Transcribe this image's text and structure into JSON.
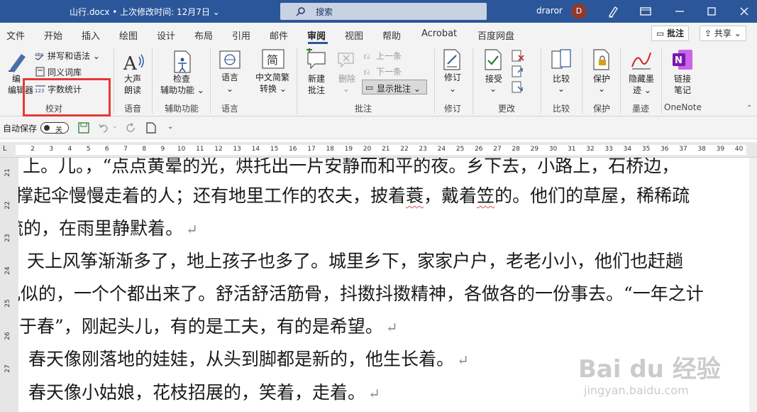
{
  "titlebar": {
    "doc_title": "山行.docx • 上次修改时间: 12月7日 ⌄",
    "search_label": "搜索",
    "username": "draror",
    "avatar_initial": "D",
    "accent_color": "#2b579a"
  },
  "menu": {
    "tabs": [
      "文件",
      "开始",
      "插入",
      "绘图",
      "设计",
      "布局",
      "引用",
      "邮件",
      "审阅",
      "视图",
      "帮助",
      "Acrobat",
      "百度网盘"
    ],
    "active_tab": "审阅",
    "comment_button": "批注",
    "share_button": "共享 ⌄"
  },
  "ribbon": {
    "proofing": {
      "edit_label_1": "编",
      "edit_label_2": "编辑器",
      "spelling": "拼写和语法 ⌄",
      "thesaurus": "同义词库",
      "word_count": "字数统计",
      "group": "校对"
    },
    "speech": {
      "read_aloud_1": "大声",
      "read_aloud_2": "朗读",
      "group": "语音"
    },
    "accessibility": {
      "check_1": "检查",
      "check_2": "辅助功能 ⌄",
      "group": "辅助功能"
    },
    "language": {
      "language": "语言",
      "language_arrow": "⌄",
      "group": "语言"
    },
    "chinese": {
      "convert_1": "中文简繁",
      "convert_2": "转换 ⌄"
    },
    "comments": {
      "new_comment_1": "新建",
      "new_comment_2": "批注",
      "delete": "删除",
      "delete_arrow": "⌄",
      "previous": "上一条",
      "next": "下一条",
      "show_comments": "显示批注 ⌄",
      "group": "批注"
    },
    "tracking": {
      "track_changes": "修订",
      "track_arrow": "⌄",
      "group": "修订"
    },
    "changes": {
      "accept": "接受",
      "accept_arrow": "⌄",
      "group": "更改"
    },
    "compare": {
      "compare": "比较",
      "compare_arrow": "⌄",
      "group": "比较"
    },
    "protect": {
      "protect": "保护",
      "protect_arrow": "⌄",
      "group": "保护"
    },
    "ink": {
      "hide_ink_1": "隐藏墨",
      "hide_ink_2": "迹 ⌄",
      "group": "墨迹"
    },
    "onenote": {
      "link_1": "链接",
      "link_2": "笔记",
      "group": "OneNote"
    }
  },
  "qat": {
    "autosave_label": "自动保存",
    "autosave_state": "关"
  },
  "ruler": {
    "corner": "L",
    "ticks": [
      "2",
      "3",
      "4",
      "5",
      "6",
      "7",
      "8",
      "9",
      "10",
      "11",
      "12",
      "13",
      "14",
      "15",
      "16",
      "17",
      "18",
      "19",
      "20",
      "21",
      "22",
      "23",
      "24",
      "25",
      "26",
      "27",
      "28",
      "29",
      "30",
      "31",
      "32",
      "33",
      "34",
      "35",
      "36",
      "37",
      "38",
      "39",
      "40"
    ],
    "vticks": [
      "21",
      "22",
      "23",
      "24",
      "25",
      "26",
      "27"
    ]
  },
  "document": {
    "lines": [
      "上。儿。，“点点黄晕的光，烘托出一片安静而和平的夜。乡下去，小路上，石桥边，",
      "撑起伞慢慢走着的人；还有地里工作的农夫，披着",
      "，戴着",
      "的。他们的草屋，稀稀疏",
      "疏的，在雨里静默着。",
      "天上风筝渐渐多了，地上孩子也多了。城里乡下，家家户户，老老小小，他们也赶趟",
      "儿似的，一个个都出来了。舒活舒活筋骨，抖擞抖擞精神，各做各的一份事去。“一年之计",
      "在于春”，刚起头儿，有的是工夫，有的是希望。",
      "春天像刚落地的娃娃，从头到脚都是新的，他生长着。",
      "春天像小姑娘，花枝招展的，笑着，走着。"
    ],
    "word_suoyi": "蓑",
    "word_douli": "笠",
    "para_mark": "↵"
  },
  "watermark": {
    "main": "Bai du 经验",
    "sub": "jingyan.baidu.com"
  }
}
